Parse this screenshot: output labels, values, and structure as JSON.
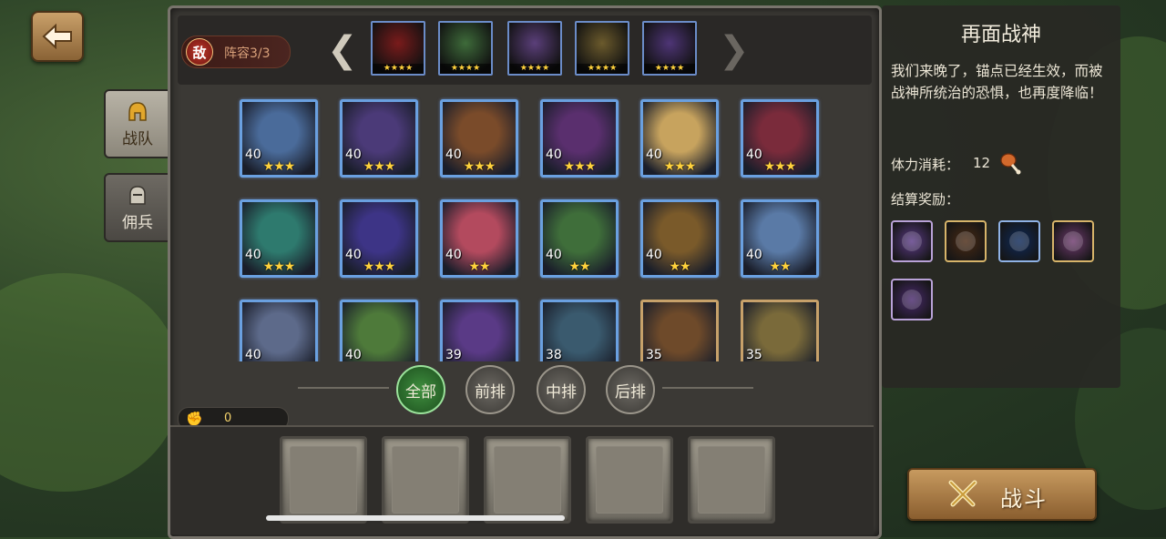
{
  "side_tabs": [
    {
      "label": "战队",
      "icon": "helmet-icon",
      "active": true
    },
    {
      "label": "佣兵",
      "icon": "knight-helmet-icon",
      "active": false
    }
  ],
  "enemy": {
    "badge_char": "敌",
    "lineup_label": "阵容3/3",
    "cards": [
      {
        "stars": "★★★★",
        "color": "#7a1b1b"
      },
      {
        "stars": "★★★★",
        "color": "#3e6b3a"
      },
      {
        "stars": "★★★★",
        "color": "#5b3f7a"
      },
      {
        "stars": "★★★★",
        "color": "#6b5a2c"
      },
      {
        "stars": "★★★★",
        "color": "#4e3576"
      }
    ]
  },
  "heroes": [
    {
      "level": "40",
      "stars": "★★★",
      "color": "#4a6b9a"
    },
    {
      "level": "40",
      "stars": "★★★",
      "color": "#4b3a78"
    },
    {
      "level": "40",
      "stars": "★★★",
      "color": "#7a4b2a"
    },
    {
      "level": "40",
      "stars": "★★★",
      "color": "#5a2f6e"
    },
    {
      "level": "40",
      "stars": "★★★",
      "color": "#c7a35e"
    },
    {
      "level": "40",
      "stars": "★★★",
      "color": "#7a2b3b"
    },
    {
      "level": "40",
      "stars": "★★★",
      "color": "#2e7a6e"
    },
    {
      "level": "40",
      "stars": "★★★",
      "color": "#3d3486"
    },
    {
      "level": "40",
      "stars": "★★",
      "color": "#b34a5e"
    },
    {
      "level": "40",
      "stars": "★★",
      "color": "#3f6e3a"
    },
    {
      "level": "40",
      "stars": "★★",
      "color": "#7a5a2a"
    },
    {
      "level": "40",
      "stars": "★★",
      "color": "#5a7aa6"
    },
    {
      "level": "40",
      "stars": "",
      "color": "#5d6a8a"
    },
    {
      "level": "40",
      "stars": "",
      "color": "#4e7a3a"
    },
    {
      "level": "39",
      "stars": "",
      "color": "#5a3a86"
    },
    {
      "level": "38",
      "stars": "",
      "color": "#3a5a6e"
    },
    {
      "level": "35",
      "stars": "",
      "color": "#6e4a2a"
    },
    {
      "level": "35",
      "stars": "",
      "color": "#7a6a3a"
    }
  ],
  "filters": [
    {
      "label": "全部",
      "active": true
    },
    {
      "label": "前排",
      "active": false
    },
    {
      "label": "中排",
      "active": false
    },
    {
      "label": "后排",
      "active": false
    }
  ],
  "power": {
    "icon": "fist-icon",
    "value": "0"
  },
  "lineup_slots": 5,
  "stage": {
    "title": "再面战神",
    "description": "我们来晚了，锚点已经生效，而被战神所统治的恐惧，也再度降临！",
    "stamina_label": "体力消耗：",
    "stamina_value": "12",
    "reward_label": "结算奖励：",
    "rewards": [
      {
        "icon": "hero-shard-icon",
        "color": "#5b3a86"
      },
      {
        "icon": "green-staff-icon",
        "color": "#4a2a14"
      },
      {
        "icon": "blue-orb-icon",
        "color": "#0e2a5a"
      },
      {
        "icon": "gold-scroll-icon",
        "color": "#6e3a6e"
      },
      {
        "icon": "purple-scroll-icon",
        "color": "#4a2a6e"
      }
    ]
  },
  "fight_button": {
    "label": "战斗"
  }
}
